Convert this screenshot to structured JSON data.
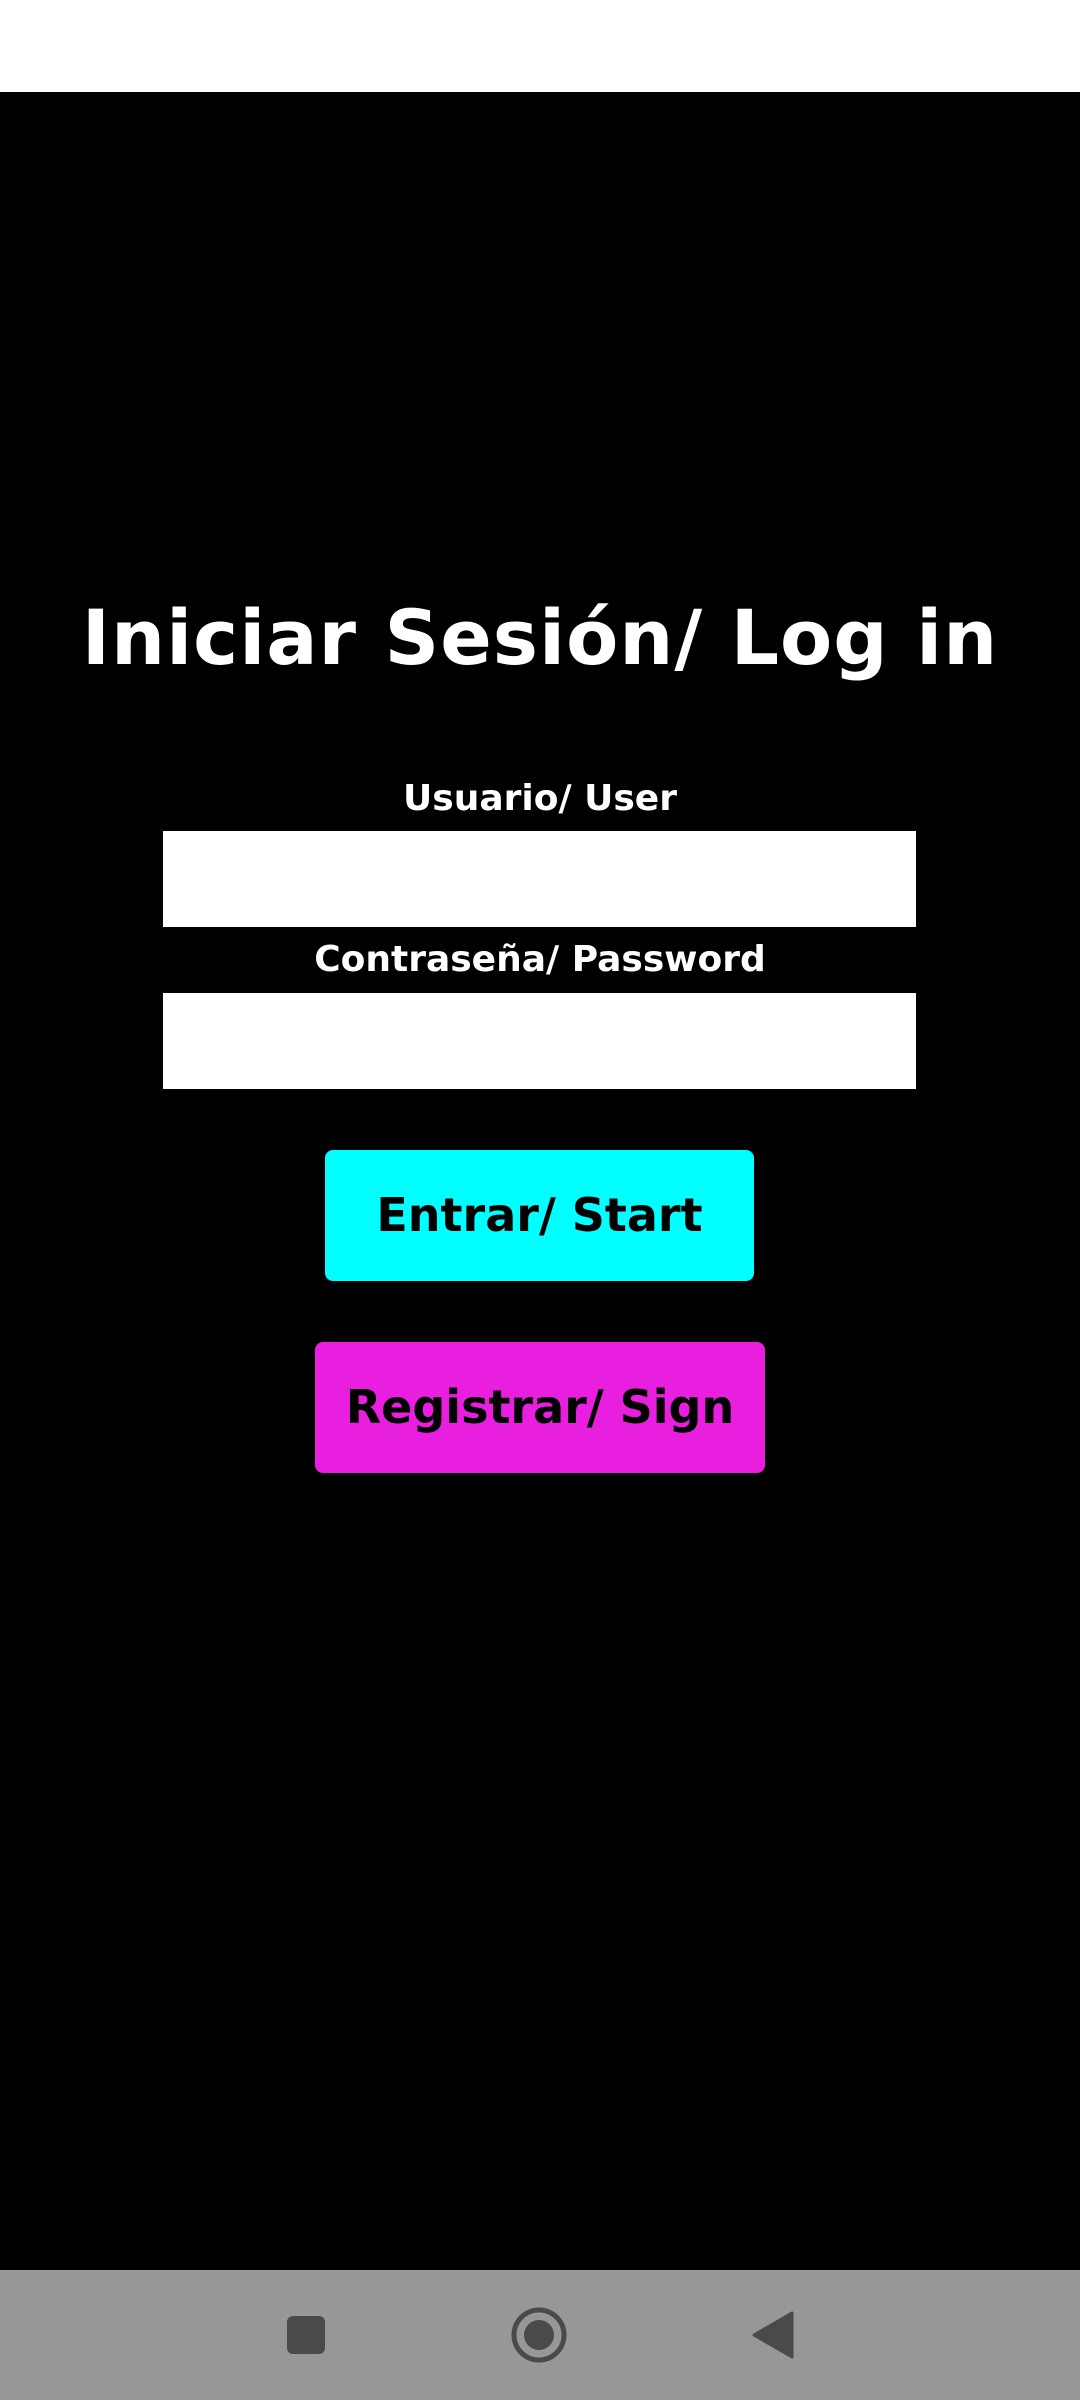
{
  "screen": {
    "title": "Iniciar Sesión/ Log in",
    "background_color": "#000000"
  },
  "form": {
    "user_label": "Usuario/ User",
    "user_value": "",
    "password_label": "Contraseña/ Password",
    "password_value": ""
  },
  "buttons": {
    "start_label": "Entrar/ Start",
    "start_color": "#00ffff",
    "register_label": "Registrar/ Sign in",
    "register_color": "#e91fe0"
  },
  "navigation_bar": {
    "background_color": "#979797",
    "icons": [
      "recents-icon",
      "home-icon",
      "back-icon"
    ]
  }
}
